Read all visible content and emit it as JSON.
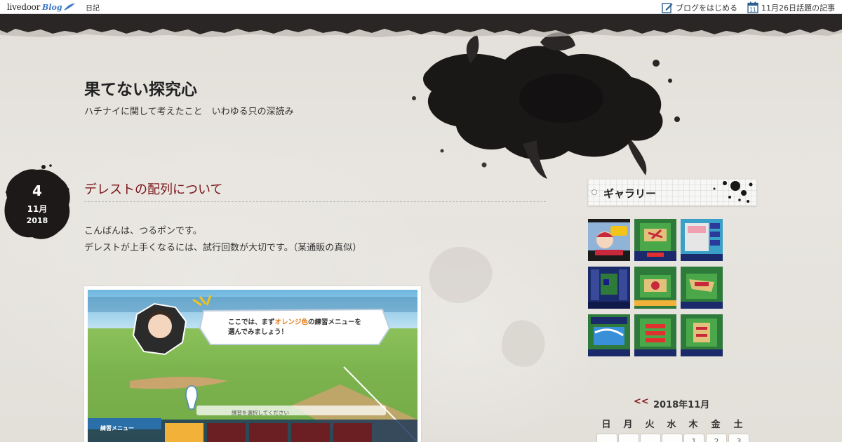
{
  "topbar": {
    "logo_primary": "livedoor",
    "logo_secondary": "Blog",
    "nav_diary": "日記",
    "start_blog": "ブログをはじめる",
    "calendar_icon_day": "11",
    "trending": "11月26日話題の記事"
  },
  "blog": {
    "title": "果てない探究心",
    "description": "ハチナイに関して考えたこと　いわゆる只の深読み"
  },
  "post": {
    "date_day": "4",
    "date_month": "11月",
    "date_year": "2018",
    "title": "デレストの配列について",
    "body_line1": "こんばんは、つるポンです。",
    "body_line2": "デレストが上手くなるには、試行回数が大切です。（某通販の真似）",
    "image": {
      "tutorial_line1_a": "ここでは、まず",
      "tutorial_line1_hl": "オレンジ色",
      "tutorial_line1_b": "の練習メニューを",
      "tutorial_line2": "選んでみましょう！",
      "select_prompt": "練習を選択してください",
      "menu_label": "練習メニュー"
    }
  },
  "sidebar": {
    "gallery_title": "ギャラリー",
    "thumbnail_count": 9,
    "calendar": {
      "prev": "<<",
      "month": "2018年11月",
      "weekdays": [
        "日",
        "月",
        "火",
        "水",
        "木",
        "金",
        "土"
      ],
      "first_week": [
        "",
        "",
        "",
        "",
        "1",
        "2",
        "3"
      ]
    }
  },
  "colors": {
    "post_title": "#7a1418",
    "ink": "#1a1717",
    "link_accent": "#8b1a1a",
    "logo_blue": "#3a76c4"
  }
}
